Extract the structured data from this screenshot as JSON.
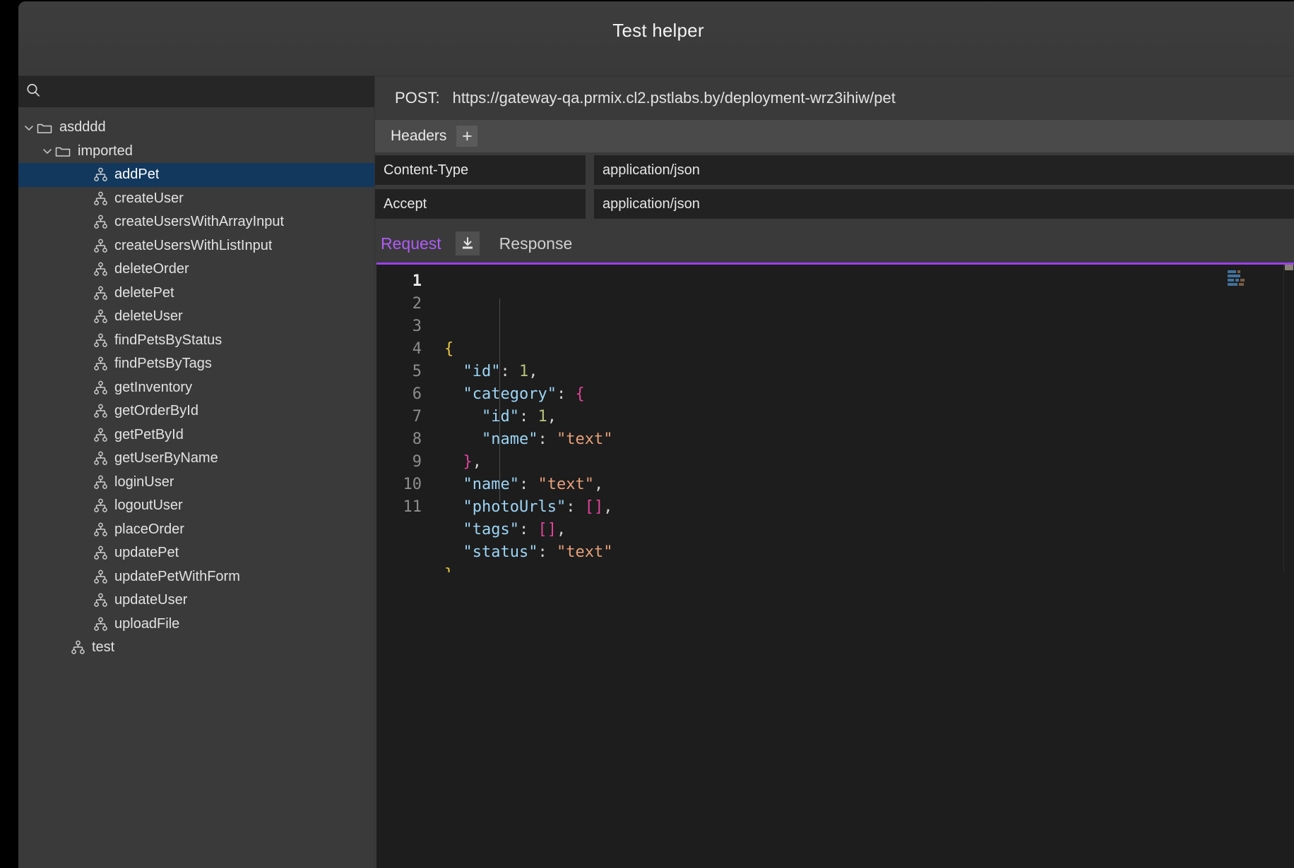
{
  "window": {
    "title": "Test helper"
  },
  "sidebar": {
    "search": {
      "value": "",
      "placeholder": "",
      "icon": "search-icon"
    },
    "tree": [
      {
        "label": "asdddd",
        "type": "folder",
        "depth": 0,
        "expanded": true,
        "selected": false,
        "icon": "folder-icon"
      },
      {
        "label": "imported",
        "type": "folder",
        "depth": 1,
        "expanded": true,
        "selected": false,
        "icon": "folder-icon"
      },
      {
        "label": "addPet",
        "type": "node",
        "depth": 2,
        "selected": true,
        "icon": "sitemap-icon"
      },
      {
        "label": "createUser",
        "type": "node",
        "depth": 2,
        "selected": false,
        "icon": "sitemap-icon"
      },
      {
        "label": "createUsersWithArrayInput",
        "type": "node",
        "depth": 2,
        "selected": false,
        "icon": "sitemap-icon"
      },
      {
        "label": "createUsersWithListInput",
        "type": "node",
        "depth": 2,
        "selected": false,
        "icon": "sitemap-icon"
      },
      {
        "label": "deleteOrder",
        "type": "node",
        "depth": 2,
        "selected": false,
        "icon": "sitemap-icon"
      },
      {
        "label": "deletePet",
        "type": "node",
        "depth": 2,
        "selected": false,
        "icon": "sitemap-icon"
      },
      {
        "label": "deleteUser",
        "type": "node",
        "depth": 2,
        "selected": false,
        "icon": "sitemap-icon"
      },
      {
        "label": "findPetsByStatus",
        "type": "node",
        "depth": 2,
        "selected": false,
        "icon": "sitemap-icon"
      },
      {
        "label": "findPetsByTags",
        "type": "node",
        "depth": 2,
        "selected": false,
        "icon": "sitemap-icon"
      },
      {
        "label": "getInventory",
        "type": "node",
        "depth": 2,
        "selected": false,
        "icon": "sitemap-icon"
      },
      {
        "label": "getOrderById",
        "type": "node",
        "depth": 2,
        "selected": false,
        "icon": "sitemap-icon"
      },
      {
        "label": "getPetById",
        "type": "node",
        "depth": 2,
        "selected": false,
        "icon": "sitemap-icon"
      },
      {
        "label": "getUserByName",
        "type": "node",
        "depth": 2,
        "selected": false,
        "icon": "sitemap-icon"
      },
      {
        "label": "loginUser",
        "type": "node",
        "depth": 2,
        "selected": false,
        "icon": "sitemap-icon"
      },
      {
        "label": "logoutUser",
        "type": "node",
        "depth": 2,
        "selected": false,
        "icon": "sitemap-icon"
      },
      {
        "label": "placeOrder",
        "type": "node",
        "depth": 2,
        "selected": false,
        "icon": "sitemap-icon"
      },
      {
        "label": "updatePet",
        "type": "node",
        "depth": 2,
        "selected": false,
        "icon": "sitemap-icon"
      },
      {
        "label": "updatePetWithForm",
        "type": "node",
        "depth": 2,
        "selected": false,
        "icon": "sitemap-icon"
      },
      {
        "label": "updateUser",
        "type": "node",
        "depth": 2,
        "selected": false,
        "icon": "sitemap-icon"
      },
      {
        "label": "uploadFile",
        "type": "node",
        "depth": 2,
        "selected": false,
        "icon": "sitemap-icon"
      },
      {
        "label": "test",
        "type": "node",
        "depth": 1,
        "selected": false,
        "icon": "sitemap-icon"
      }
    ]
  },
  "request": {
    "method_label": "POST:",
    "url": "https://gateway-qa.prmix.cl2.pstlabs.by/deployment-wrz3ihiw/pet",
    "headers_section": {
      "title": "Headers",
      "add_button_label": "+"
    },
    "headers": [
      {
        "key": "Content-Type",
        "value": "application/json"
      },
      {
        "key": "Accept",
        "value": "application/json"
      }
    ],
    "tabs": [
      {
        "label": "Request",
        "active": true
      },
      {
        "label": "Response",
        "active": false
      }
    ],
    "download_button": "download-icon",
    "editor": {
      "line_numbers": [
        "1",
        "2",
        "3",
        "4",
        "5",
        "6",
        "7",
        "8",
        "9",
        "10",
        "11"
      ],
      "current_line": 1,
      "lines": [
        [
          {
            "t": "{",
            "c": "brace"
          }
        ],
        [
          {
            "t": "  ",
            "c": "punct"
          },
          {
            "t": "\"id\"",
            "c": "key"
          },
          {
            "t": ": ",
            "c": "punct"
          },
          {
            "t": "1",
            "c": "num"
          },
          {
            "t": ",",
            "c": "punct"
          }
        ],
        [
          {
            "t": "  ",
            "c": "punct"
          },
          {
            "t": "\"category\"",
            "c": "key"
          },
          {
            "t": ": ",
            "c": "punct"
          },
          {
            "t": "{",
            "c": "brace2"
          }
        ],
        [
          {
            "t": "    ",
            "c": "punct"
          },
          {
            "t": "\"id\"",
            "c": "key"
          },
          {
            "t": ": ",
            "c": "punct"
          },
          {
            "t": "1",
            "c": "num"
          },
          {
            "t": ",",
            "c": "punct"
          }
        ],
        [
          {
            "t": "    ",
            "c": "punct"
          },
          {
            "t": "\"name\"",
            "c": "key"
          },
          {
            "t": ": ",
            "c": "punct"
          },
          {
            "t": "\"text\"",
            "c": "str"
          }
        ],
        [
          {
            "t": "  ",
            "c": "punct"
          },
          {
            "t": "}",
            "c": "brace2"
          },
          {
            "t": ",",
            "c": "punct"
          }
        ],
        [
          {
            "t": "  ",
            "c": "punct"
          },
          {
            "t": "\"name\"",
            "c": "key"
          },
          {
            "t": ": ",
            "c": "punct"
          },
          {
            "t": "\"text\"",
            "c": "str"
          },
          {
            "t": ",",
            "c": "punct"
          }
        ],
        [
          {
            "t": "  ",
            "c": "punct"
          },
          {
            "t": "\"photoUrls\"",
            "c": "key"
          },
          {
            "t": ": ",
            "c": "punct"
          },
          {
            "t": "[]",
            "c": "brace2"
          },
          {
            "t": ",",
            "c": "punct"
          }
        ],
        [
          {
            "t": "  ",
            "c": "punct"
          },
          {
            "t": "\"tags\"",
            "c": "key"
          },
          {
            "t": ": ",
            "c": "punct"
          },
          {
            "t": "[]",
            "c": "brace2"
          },
          {
            "t": ",",
            "c": "punct"
          }
        ],
        [
          {
            "t": "  ",
            "c": "punct"
          },
          {
            "t": "\"status\"",
            "c": "key"
          },
          {
            "t": ": ",
            "c": "punct"
          },
          {
            "t": "\"text\"",
            "c": "str"
          }
        ],
        [
          {
            "t": "}",
            "c": "brace"
          }
        ]
      ]
    }
  },
  "colors": {
    "window_bg": "#3a3a3a",
    "editor_bg": "#1d1d1d",
    "selection_blue": "#12385e",
    "accent_purple": "#b05cf7",
    "tab_underline": "#9d3ef0",
    "field_bg": "#222222",
    "headers_bar_bg": "#4a4a4a"
  }
}
